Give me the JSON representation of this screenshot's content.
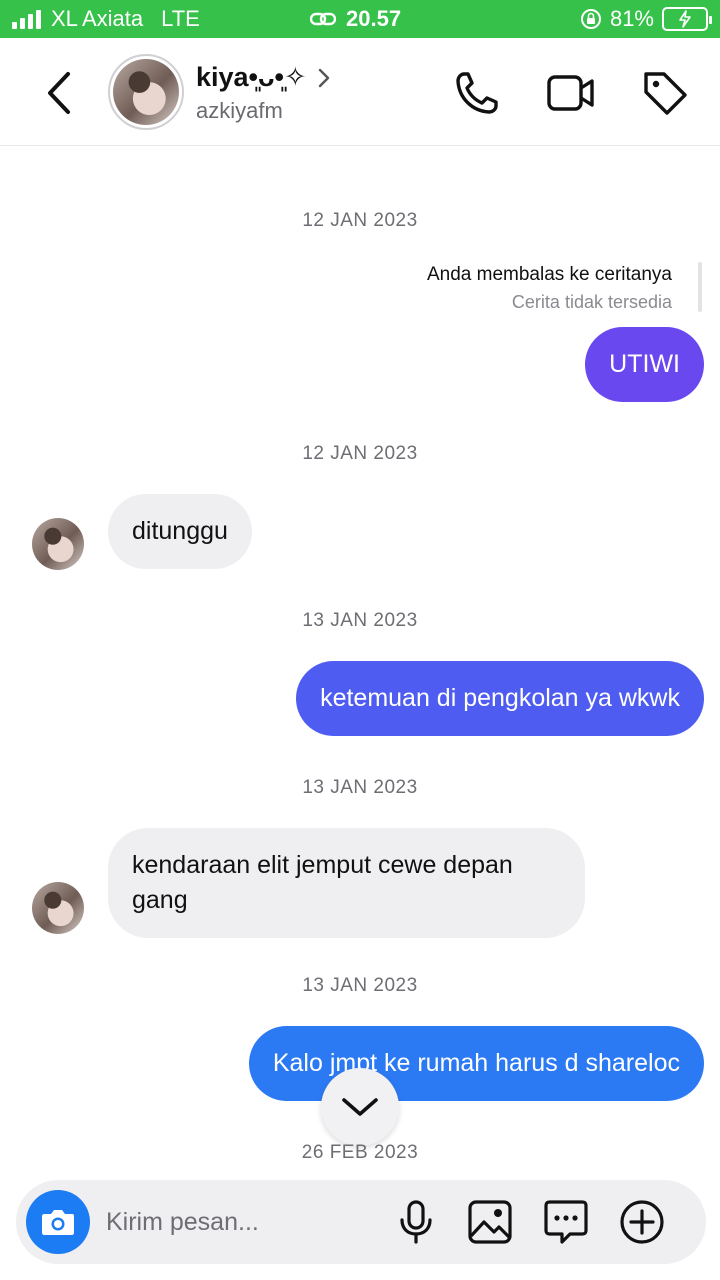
{
  "status_bar": {
    "carrier": "XL Axiata",
    "network": "LTE",
    "time": "20.57",
    "battery": "81%"
  },
  "header": {
    "name": "kiya•͈ᴗ•͈✧",
    "username": "azkiyafm"
  },
  "colors": {
    "status_green": "#36c24a",
    "bubble_purple": "#6a48f0",
    "bubble_indigo": "#4e5cf2",
    "bubble_blue": "#2c7af3",
    "incoming_bg": "#efeff1",
    "camera_blue": "#1c7cf4"
  },
  "icons": [
    "back-chevron-icon",
    "chevron-right-icon",
    "phone-icon",
    "video-icon",
    "tag-icon",
    "chevron-down-icon",
    "camera-icon",
    "mic-icon",
    "gallery-icon",
    "sticker-chat-icon",
    "plus-circle-icon"
  ],
  "chat": {
    "dates": [
      "12 JAN 2023",
      "12 JAN 2023",
      "13 JAN 2023",
      "13 JAN 2023",
      "13 JAN 2023",
      "26 FEB 2023"
    ],
    "story_reply": {
      "title": "Anda membalas ke ceritanya",
      "subtitle": "Cerita tidak tersedia"
    },
    "messages": [
      {
        "from": "me",
        "text": "UTIWI"
      },
      {
        "from": "them",
        "text": "ditunggu"
      },
      {
        "from": "me",
        "text": "ketemuan di pengkolan ya wkwk"
      },
      {
        "from": "them",
        "text": "kendaraan elit jemput cewe depan gang"
      },
      {
        "from": "me",
        "text": "Kalo jmpt ke rumah harus d shareloc"
      }
    ]
  },
  "composer": {
    "placeholder": "Kirim pesan..."
  }
}
